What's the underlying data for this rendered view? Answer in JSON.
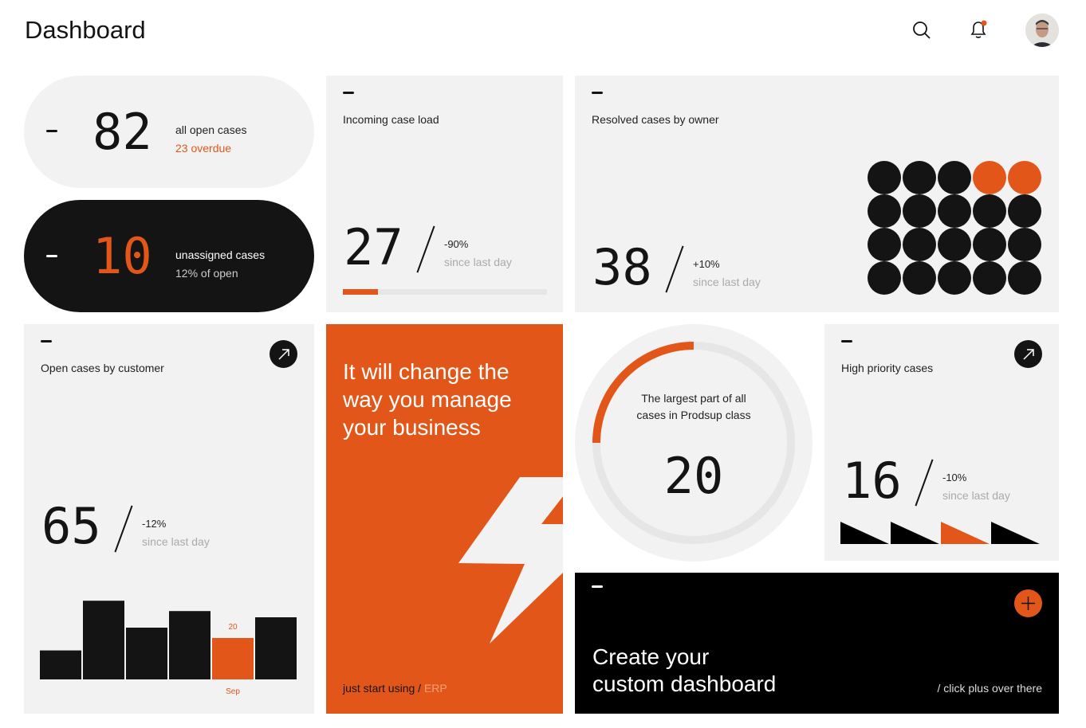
{
  "header": {
    "title": "Dashboard",
    "icons": [
      "search-icon",
      "bell-icon",
      "avatar"
    ]
  },
  "colors": {
    "accent": "#e25719",
    "dark": "#141414",
    "card": "#f2f2f2"
  },
  "open_cases": {
    "value": "82",
    "label": "all open cases",
    "sub": "23 overdue"
  },
  "unassigned": {
    "value": "10",
    "label": "unassigned cases",
    "sub": "12% of open"
  },
  "incoming": {
    "title": "Incoming case load",
    "value": "27",
    "change": "-90%",
    "since": "since last day",
    "progress_percent": 17
  },
  "resolved": {
    "title": "Resolved cases by owner",
    "value": "38",
    "change": "+10%",
    "since": "since last day",
    "dots_total": 20,
    "dots_highlighted": [
      3,
      4
    ]
  },
  "by_customer": {
    "title": "Open cases by customer",
    "value": "65",
    "change": "-12%",
    "since": "since last day",
    "chart_data": {
      "type": "bar",
      "values": [
        14,
        38,
        25,
        33,
        20,
        30
      ],
      "highlight_index": 4,
      "highlight_label": "20",
      "highlight_category": "Sep"
    }
  },
  "promo": {
    "headline": "It will change the way you manage your business",
    "footer": "just start using",
    "footer_accent": "ERP"
  },
  "largest": {
    "text": "The largest part of all cases in Prodsup class",
    "value": "20",
    "ring_fraction": 0.25
  },
  "high_priority": {
    "title": "High priority cases",
    "value": "16",
    "change": "-10%",
    "since": "since last day",
    "highlight_index": 2
  },
  "create": {
    "title_line1": "Create your",
    "title_line2": "custom dashboard",
    "hint": "/ click plus over there"
  }
}
